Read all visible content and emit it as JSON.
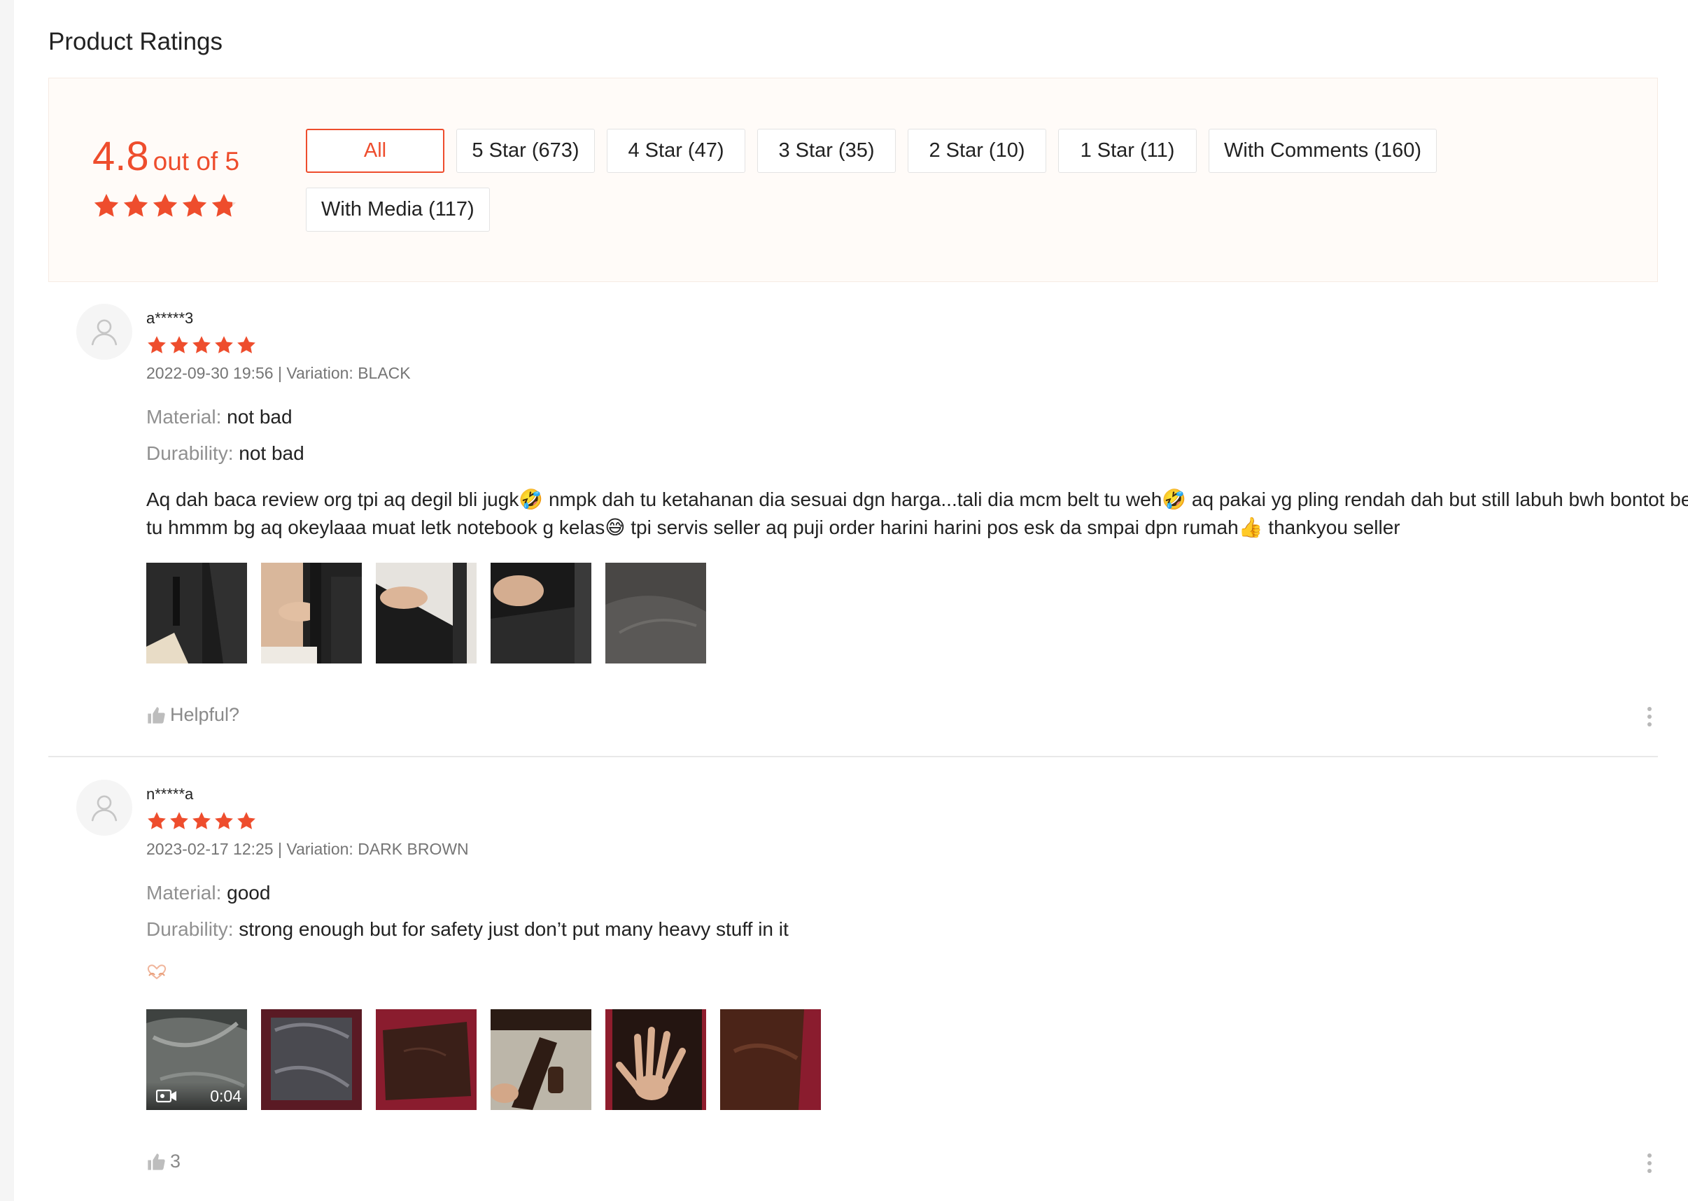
{
  "section": {
    "title": "Product Ratings"
  },
  "overview": {
    "score": "4.8",
    "out_of": "out of 5",
    "star_rating": 4.8,
    "filters": [
      {
        "label": "All",
        "active": true
      },
      {
        "label": "5 Star (673)",
        "active": false
      },
      {
        "label": "4 Star (47)",
        "active": false
      },
      {
        "label": "3 Star (35)",
        "active": false
      },
      {
        "label": "2 Star (10)",
        "active": false
      },
      {
        "label": "1 Star (11)",
        "active": false
      },
      {
        "label": "With Comments (160)",
        "active": false
      },
      {
        "label": "With Media (117)",
        "active": false
      }
    ]
  },
  "reviews": [
    {
      "username": "a*****3",
      "stars": 5,
      "meta": "2022-09-30 19:56 | Variation: BLACK",
      "material_key": "Material:",
      "material_value": "not bad",
      "durability_key": "Durability:",
      "durability_value": "not bad",
      "comment": "Aq dah baca review org tpi aq degil bli jugk🤣 nmpk dah tu ketahanan dia sesuai dgn harga...tali dia mcm belt tu weh🤣 aq pakai yg pling rendah dah but still labuh bwh bontot beg tu hmmm bg aq okeylaaa muat letk notebook g kelas😅 tpi servis seller aq puji order harini harini pos esk da smpai dpn rumah👍 thankyou seller",
      "helpful_label": "Helpful?",
      "media_count": 5
    },
    {
      "username": "n*****a",
      "stars": 5,
      "meta": "2023-02-17 12:25 | Variation: DARK BROWN",
      "material_key": "Material:",
      "material_value": "good",
      "durability_key": "Durability:",
      "durability_value": "strong enough but for safety just don’t put many heavy stuff in it",
      "comment": "🫶",
      "video_duration": "0:04",
      "helpful_count": "3",
      "media_count": 6
    }
  ],
  "colors": {
    "accent": "#ee4d2d",
    "muted": "#757575"
  }
}
